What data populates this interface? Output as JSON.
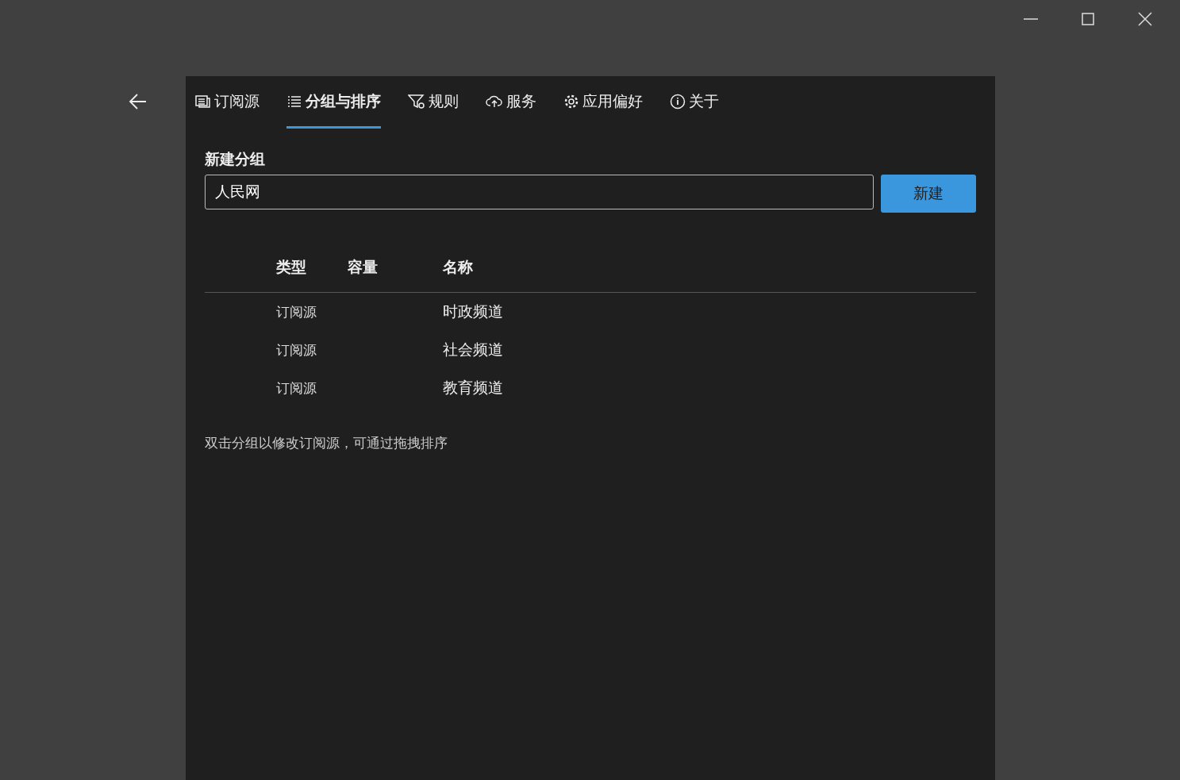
{
  "tabs": [
    {
      "label": "订阅源",
      "kind": "feeds",
      "selected": false
    },
    {
      "label": "分组与排序",
      "kind": "groups",
      "selected": true
    },
    {
      "label": "规则",
      "kind": "rules",
      "selected": false
    },
    {
      "label": "服务",
      "kind": "service",
      "selected": false
    },
    {
      "label": "应用偏好",
      "kind": "prefs",
      "selected": false
    },
    {
      "label": "关于",
      "kind": "about",
      "selected": false
    }
  ],
  "new_group": {
    "heading": "新建分组",
    "value": "人民网",
    "button": "新建"
  },
  "table": {
    "columns": [
      "类型",
      "容量",
      "名称"
    ],
    "rows": [
      {
        "type": "订阅源",
        "name": "时政频道"
      },
      {
        "type": "订阅源",
        "name": "社会频道"
      },
      {
        "type": "订阅源",
        "name": "教育频道"
      }
    ]
  },
  "hint": "双击分组以修改订阅源，可通过拖拽排序"
}
